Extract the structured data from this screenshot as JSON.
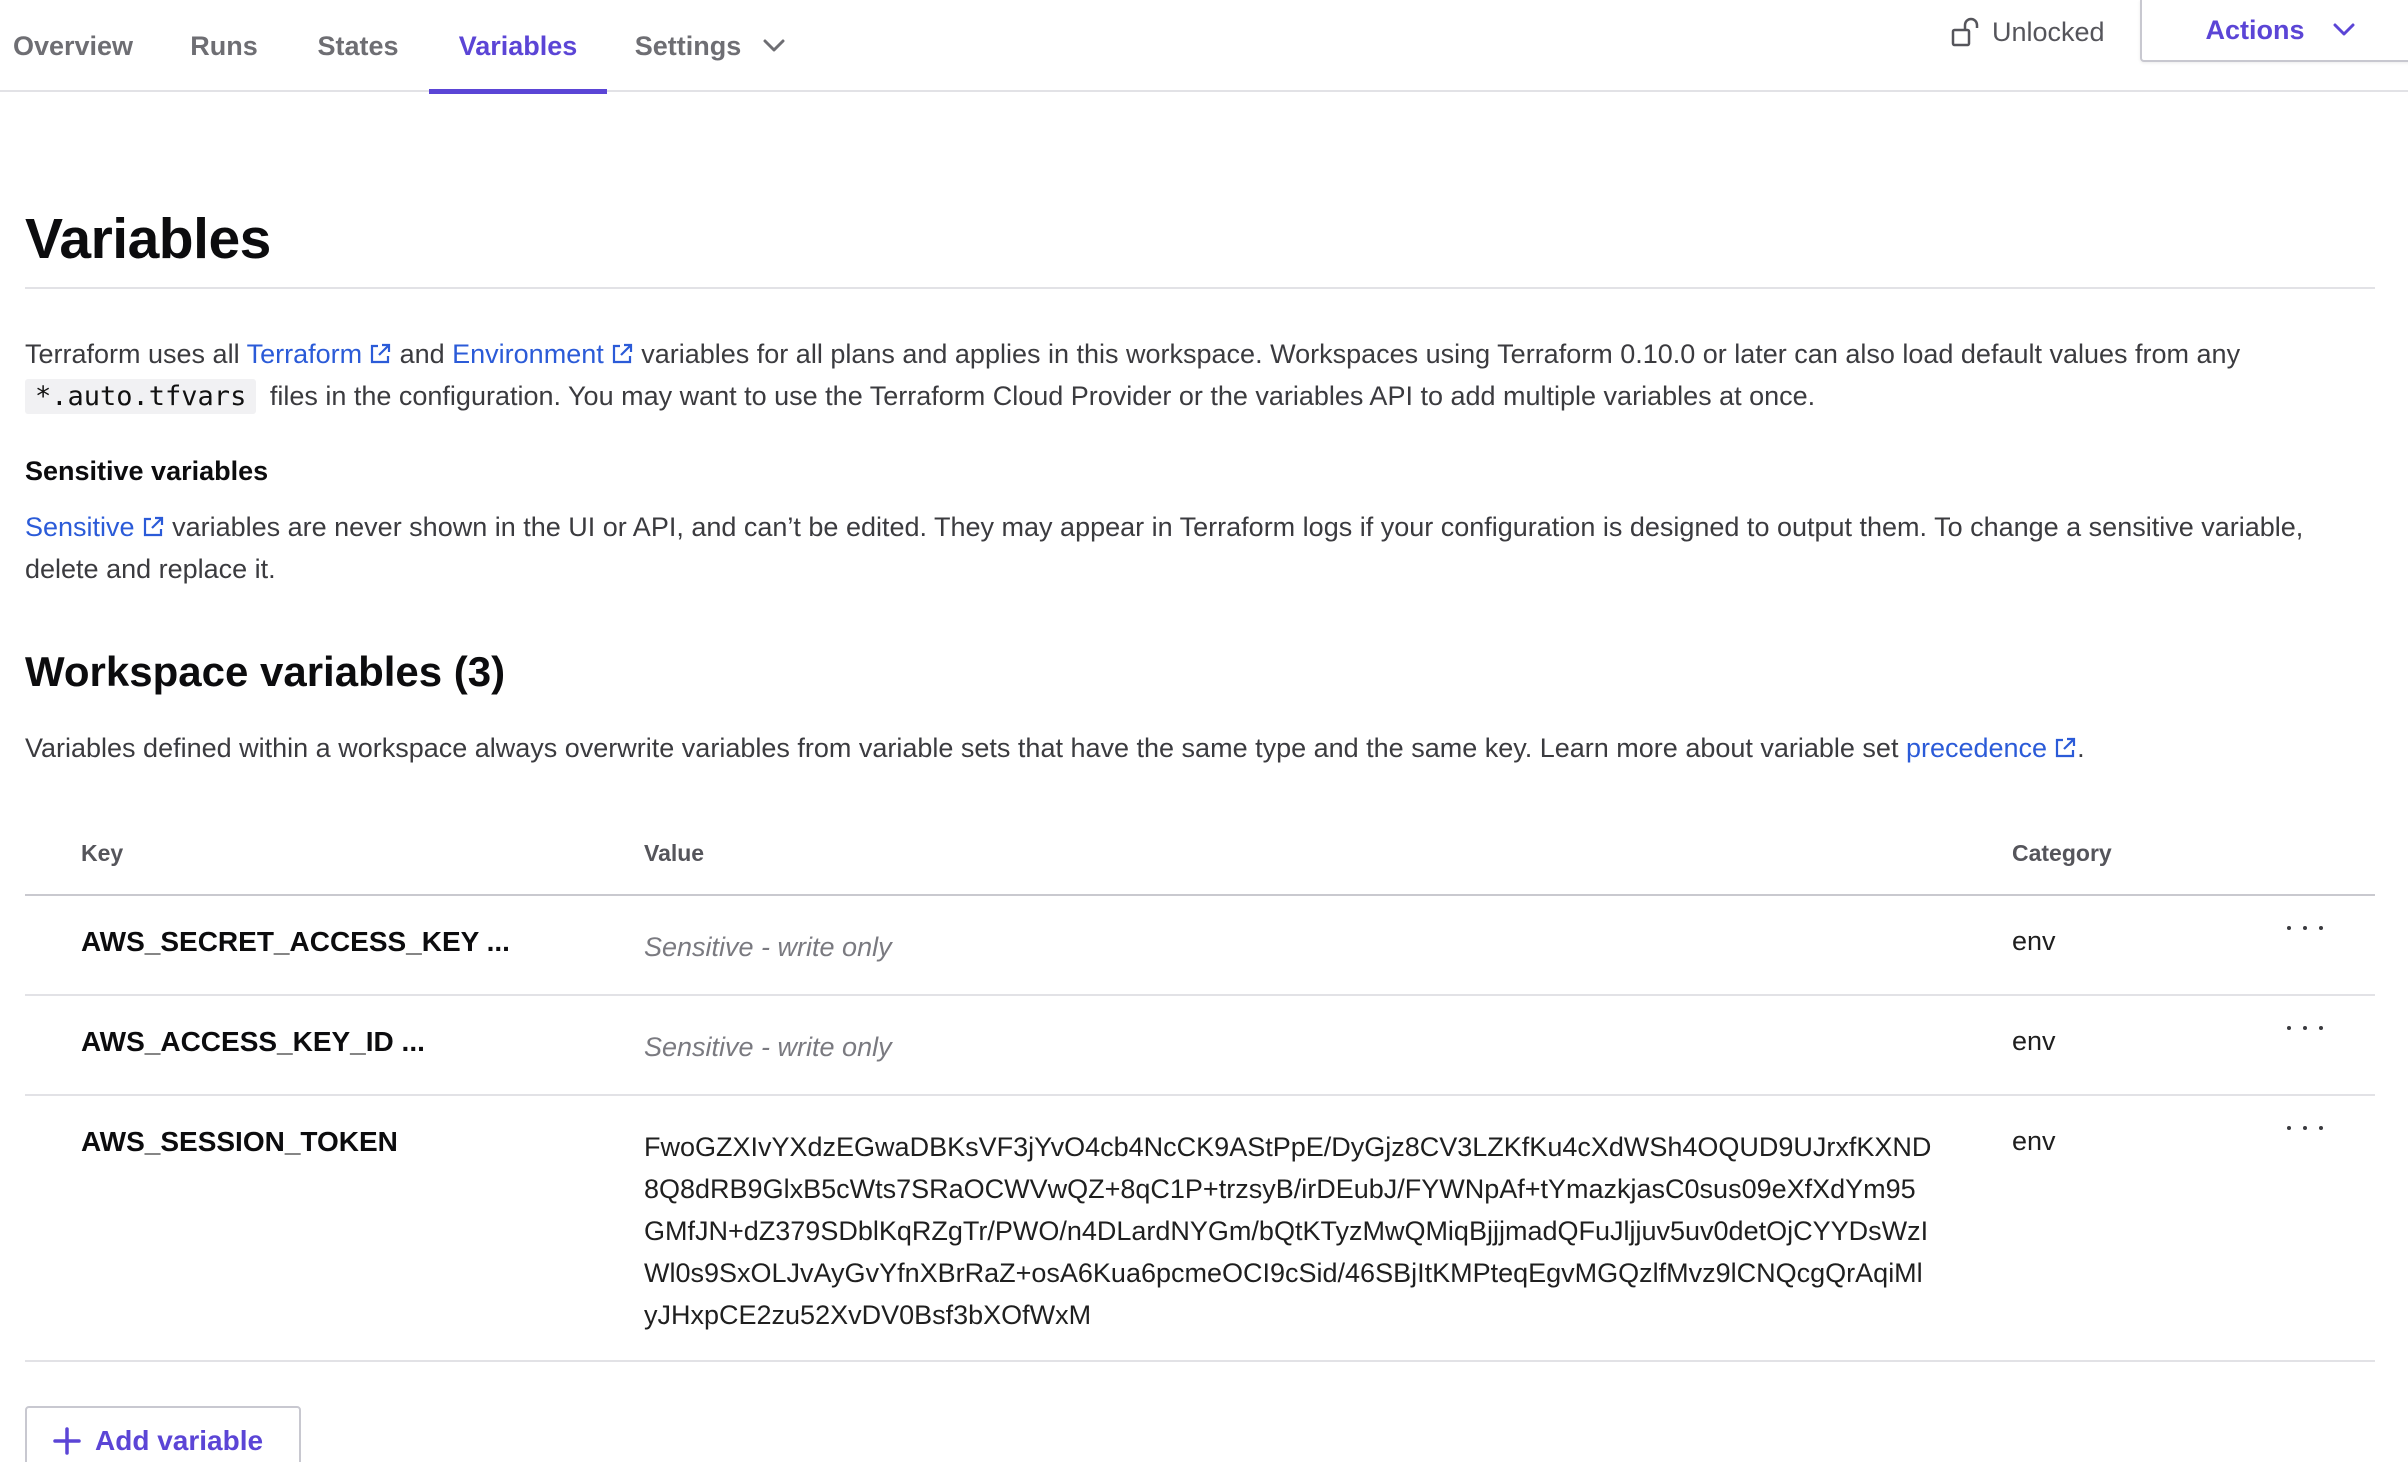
{
  "nav": {
    "tabs": [
      {
        "label": "Overview"
      },
      {
        "label": "Runs"
      },
      {
        "label": "States"
      },
      {
        "label": "Variables"
      },
      {
        "label": "Settings"
      }
    ],
    "lock_status": "Unlocked",
    "actions_label": "Actions"
  },
  "page": {
    "title": "Variables",
    "intro_1": "Terraform uses all ",
    "intro_link_terraform": "Terraform",
    "intro_and": " and ",
    "intro_link_env": "Environment",
    "intro_2": " variables for all plans and applies in this workspace. Workspaces using Terraform 0.10.0 or later can also load default values from any ",
    "intro_code": "*.auto.tfvars",
    "intro_3": " files in the configuration. You may want to use the Terraform Cloud Provider or the variables API to add multiple variables at once.",
    "sensitive_heading": "Sensitive variables",
    "sensitive_link": "Sensitive",
    "sensitive_text": " variables are never shown in the UI or API, and can’t be edited. They may appear in Terraform logs if your configuration is designed to output them. To change a sensitive variable, delete and replace it.",
    "workspace_heading": "Workspace variables (3)",
    "workspace_text": "Variables defined within a workspace always overwrite variables from variable sets that have the same type and the same key. Learn more about variable set ",
    "workspace_link": "precedence",
    "workspace_end": "."
  },
  "table": {
    "headers": {
      "key": "Key",
      "value": "Value",
      "category": "Category"
    },
    "rows": [
      {
        "key": "AWS_SECRET_ACCESS_KEY ...",
        "value": "Sensitive - write only",
        "category": "env"
      },
      {
        "key": "AWS_ACCESS_KEY_ID ...",
        "value": "Sensitive - write only",
        "category": "env"
      },
      {
        "key": "AWS_SESSION_TOKEN",
        "value": "FwoGZXIvYXdzEGwaDBKsVF3jYvO4cb4NcCK9AStPpE/DyGjz8CV3LZKfKu4cXdWSh4OQUD9UJrxfKXND8Q8dRB9GlxB5cWts7SRaOCWVwQZ+8qC1P+trzsyB/irDEubJ/FYWNpAf+tYmazkjasC0sus09eXfXdYm95GMfJN+dZ379SDblKqRZgTr/PWO/n4DLardNYGm/bQtKTyzMwQMiqBjjjmadQFuJljjuv5uv0detOjCYYDsWzIWl0s9SxOLJvAyGvYfnXBrRaZ+osA6Kua6pcmeOCI9cSid/46SBjItKMPteqEgvMGQzlfMvz9lCNQcgQrAqiMlyJHxpCE2zu52XvDV0Bsf3bXOfWxM",
        "category": "env"
      }
    ]
  },
  "add_button_label": "Add variable",
  "colors": {
    "accent": "#5b45d6",
    "link": "#2b5bd8"
  }
}
